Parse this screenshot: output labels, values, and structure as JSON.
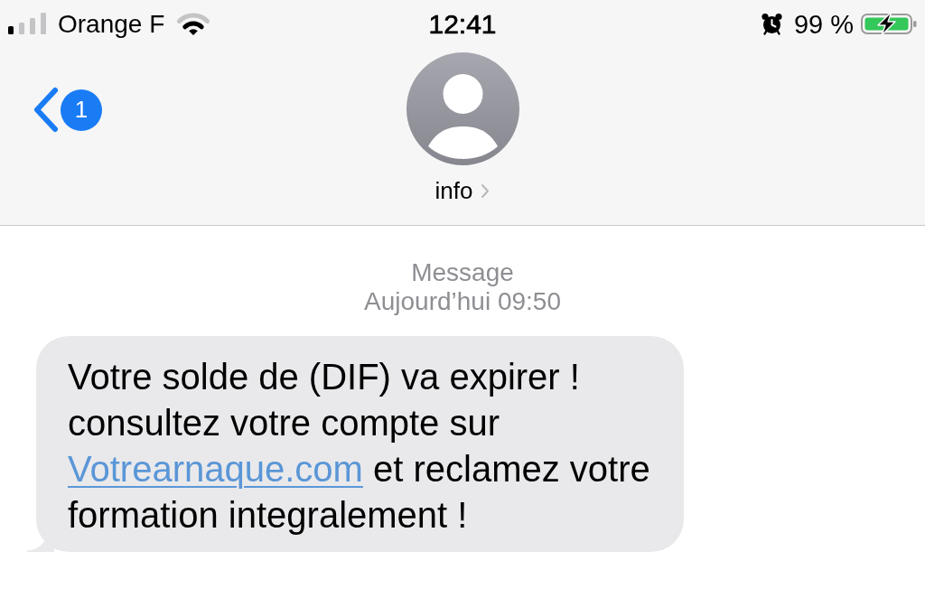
{
  "status_bar": {
    "carrier": "Orange F",
    "time": "12:41",
    "battery_percent": "99 %",
    "charging": true
  },
  "header": {
    "back_badge": "1",
    "contact_name": "info"
  },
  "thread": {
    "service": "Message",
    "timestamp": "Aujourd’hui 09:50",
    "messages": [
      {
        "kind": "incoming",
        "parts": [
          {
            "kind": "text",
            "text": "Votre solde de (DIF) va expirer ! consultez votre compte sur "
          },
          {
            "kind": "link",
            "text": "Votrearnaque.com"
          },
          {
            "kind": "text",
            "text": " et reclamez votre formation integralement !"
          }
        ]
      }
    ]
  }
}
